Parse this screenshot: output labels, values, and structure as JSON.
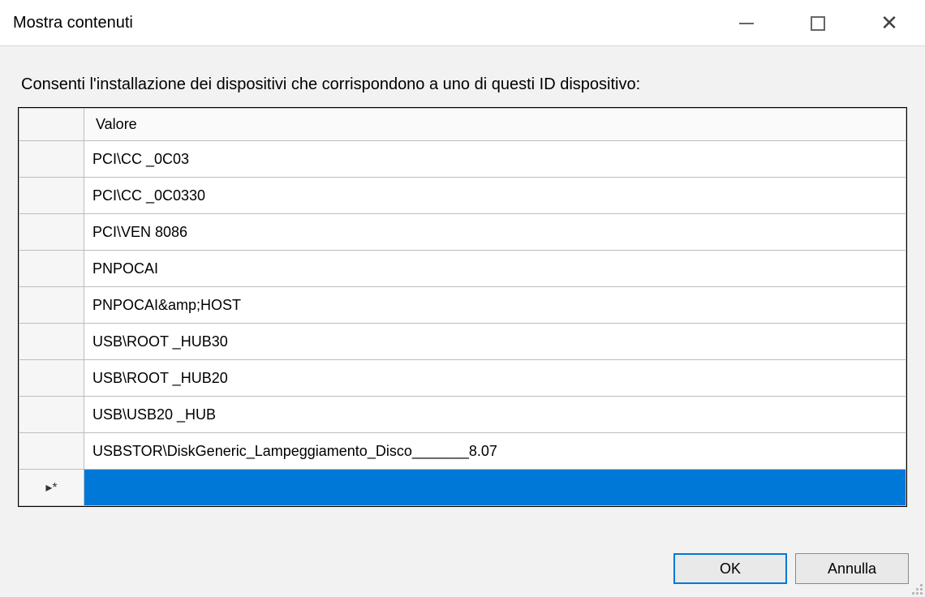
{
  "window": {
    "title": "Mostra contenuti"
  },
  "prompt": "Consenti l'installazione dei dispositivi che corrispondono a uno di questi ID dispositivo:",
  "column_header": "Valore",
  "rows": [
    "PCI\\CC _0C03",
    "PCI\\CC _0C0330",
    "PCI\\VEN 8086",
    "PNPOCAI",
    "PNPOCAI&amp;HOST",
    "USB\\ROOT _HUB30",
    "USB\\ROOT _HUB20",
    "USB\\USB20 _HUB",
    "USBSTOR\\DiskGeneric_Lampeggiamento_Disco_______8.07"
  ],
  "new_row_marker": "▸*",
  "buttons": {
    "ok": "OK",
    "cancel": "Annulla"
  }
}
